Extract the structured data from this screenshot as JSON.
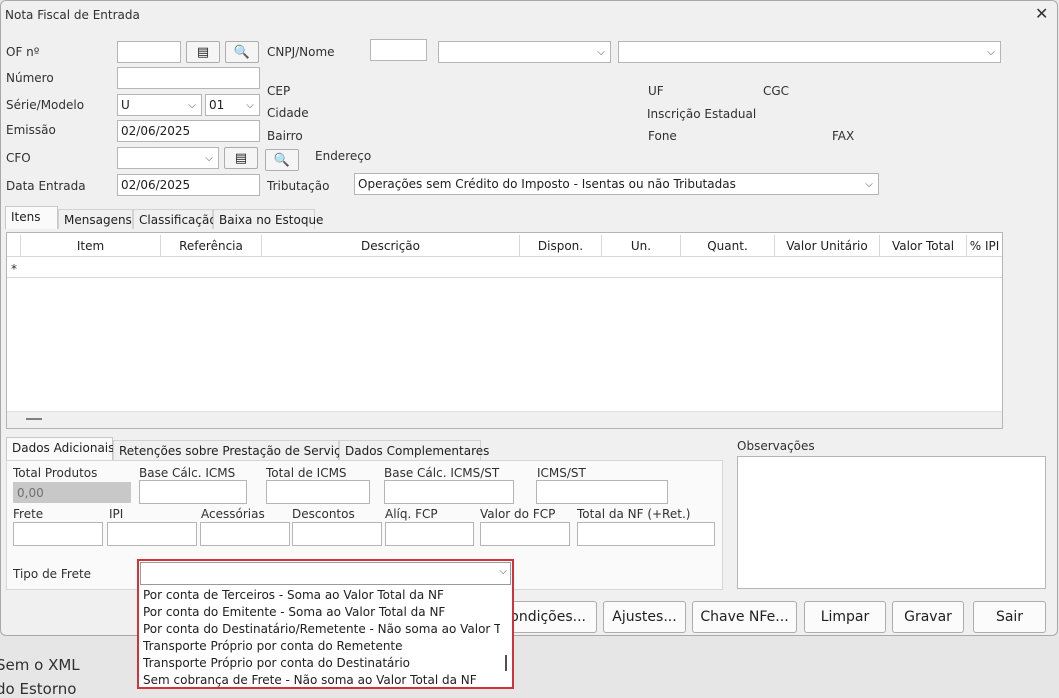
{
  "window": {
    "title": "Nota Fiscal de Entrada"
  },
  "header": {
    "of_label": "OF nº",
    "numero_label": "Número",
    "serie_label": "Série/Modelo",
    "serie_value": "U",
    "modelo_value": "01",
    "emissao_label": "Emissão",
    "emissao_value": "02/06/2025",
    "cfo_label": "CFO",
    "data_entrada_label": "Data Entrada",
    "data_entrada_value": "02/06/2025",
    "cnpj_label": "CNPJ/Nome",
    "cep_label": "CEP",
    "cidade_label": "Cidade",
    "bairro_label": "Bairro",
    "endereco_label": "Endereço",
    "uf_label": "UF",
    "cgc_label": "CGC",
    "ie_label": "Inscrição Estadual",
    "fone_label": "Fone",
    "fax_label": "FAX",
    "tributacao_label": "Tributação",
    "tributacao_value": "Operações sem Crédito do Imposto - Isentas ou não Tributadas"
  },
  "tabs": [
    "Itens",
    "Mensagens",
    "Classificação",
    "Baixa no Estoque"
  ],
  "grid": {
    "columns": [
      "Item",
      "Referência",
      "Descrição",
      "Dispon.",
      "Un.",
      "Quant.",
      "Valor Unitário",
      "Valor Total",
      "% IPI"
    ],
    "new_row_marker": "*"
  },
  "bottom_tabs": [
    "Dados Adicionais",
    "Retenções sobre Prestação de Serviços",
    "Dados Complementares"
  ],
  "totals": {
    "total_produtos_label": "Total Produtos",
    "total_produtos_value": "0,00",
    "base_icms_label": "Base Cálc. ICMS",
    "total_icms_label": "Total de ICMS",
    "base_icms_st_label": "Base Cálc. ICMS/ST",
    "icms_st_label": "ICMS/ST",
    "frete_label": "Frete",
    "ipi_label": "IPI",
    "acessorias_label": "Acessórias",
    "descontos_label": "Descontos",
    "aliq_fcp_label": "Alíq. FCP",
    "valor_fcp_label": "Valor do FCP",
    "total_nf_label": "Total da NF (+Ret.)",
    "tipo_frete_label": "Tipo de Frete"
  },
  "observacoes_label": "Observações",
  "frete_options": [
    "Por conta de Terceiros - Soma ao Valor Total da NF",
    "Por conta do Emitente - Soma ao Valor Total da NF",
    "Por conta do Destinatário/Remetente - Não soma ao Valor Total",
    "Transporte Próprio por conta do Remetente",
    "Transporte Próprio por conta do Destinatário",
    "Sem cobrança de Frete - Não soma ao Valor Total da NF"
  ],
  "buttons": {
    "condicoes": "ondições...",
    "ajustes": "Ajustes...",
    "chave_nfe": "Chave NFe...",
    "limpar": "Limpar",
    "gravar": "Gravar",
    "sair": "Sair"
  },
  "background_text": {
    "line1": "Sem o XML",
    "line2": "do Estorno"
  },
  "colors": {
    "accent_red": "#d0343a",
    "window_bg": "#f0f0f0"
  }
}
